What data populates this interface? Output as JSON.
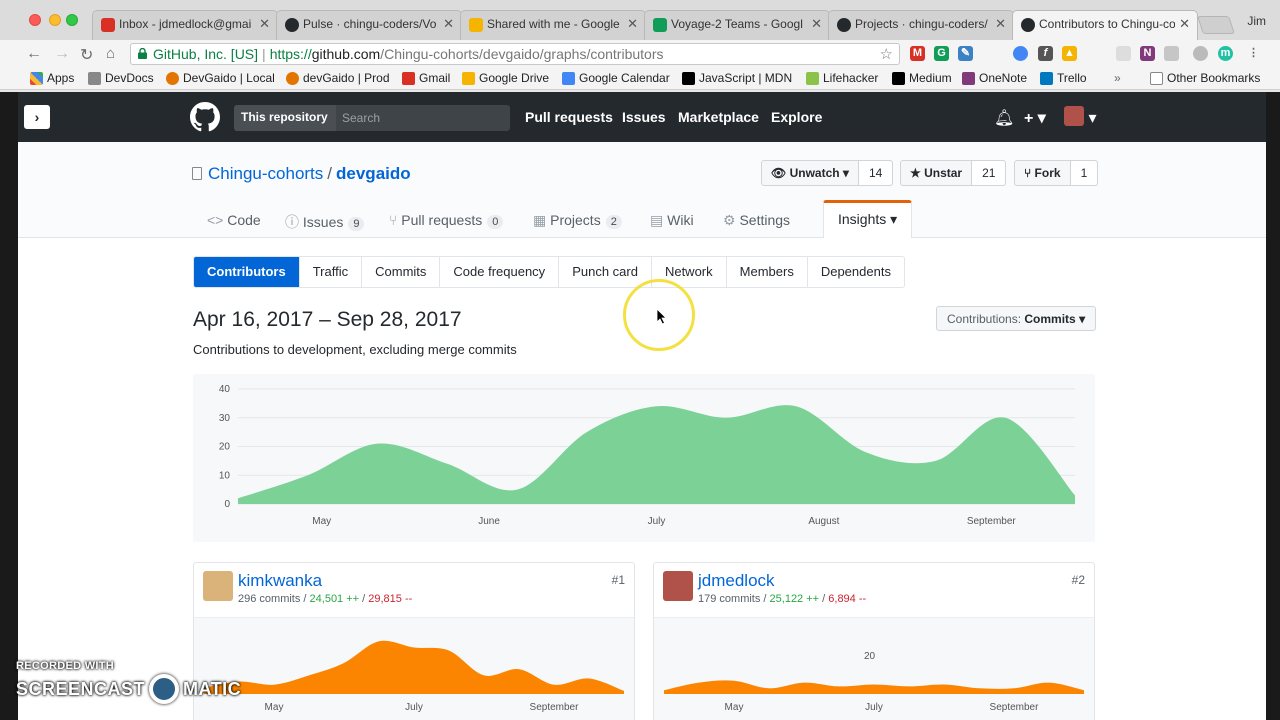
{
  "browser": {
    "tabs": [
      {
        "label": "Inbox - jdmedlock@gmai",
        "favicon_color": "#d93025",
        "active": false
      },
      {
        "label": "Pulse · chingu-coders/Vo",
        "favicon_color": "#24292e",
        "active": false
      },
      {
        "label": "Shared with me - Google",
        "favicon_color": "#f4b400",
        "active": false
      },
      {
        "label": "Voyage-2 Teams - Googl",
        "favicon_color": "#0f9d58",
        "active": false
      },
      {
        "label": "Projects · chingu-coders/",
        "favicon_color": "#24292e",
        "active": false
      },
      {
        "label": "Contributors to Chingu-co",
        "favicon_color": "#24292e",
        "active": true
      }
    ],
    "profile_name": "Jim",
    "address": {
      "secure_label": "GitHub, Inc. [US]",
      "protocol": "https://",
      "host": "github.com",
      "path": "/Chingu-cohorts/devgaido/graphs/contributors"
    },
    "bookmarks": [
      {
        "label": "Apps",
        "color": "#e8453c"
      },
      {
        "label": "DevDocs",
        "color": "#888888"
      },
      {
        "label": "DevGaido | Local",
        "color": "#e37400"
      },
      {
        "label": "devGaido | Prod",
        "color": "#e37400"
      },
      {
        "label": "Gmail",
        "color": "#d93025"
      },
      {
        "label": "Google Drive",
        "color": "#f4b400"
      },
      {
        "label": "Google Calendar",
        "color": "#4285f4"
      },
      {
        "label": "JavaScript | MDN",
        "color": "#000000"
      },
      {
        "label": "Lifehacker",
        "color": "#8bc34a"
      },
      {
        "label": "Medium",
        "color": "#000000"
      },
      {
        "label": "OneNote",
        "color": "#80397b"
      },
      {
        "label": "Trello",
        "color": "#0079bf"
      }
    ],
    "bookmarks_overflow": "»",
    "other_bookmarks": "Other Bookmarks"
  },
  "github": {
    "search_scope": "This repository",
    "search_placeholder": "Search",
    "nav": [
      "Pull requests",
      "Issues",
      "Marketplace",
      "Explore"
    ],
    "repo_owner": "Chingu-cohorts",
    "repo_name": "devgaido",
    "buttons": {
      "watch": {
        "label": "Unwatch ▾",
        "count": "14"
      },
      "star": {
        "label": "Unstar",
        "count": "21"
      },
      "fork": {
        "label": "Fork",
        "count": "1"
      }
    },
    "reponav": [
      {
        "label": "Code",
        "count": "",
        "icon": "<>"
      },
      {
        "label": "Issues",
        "count": "9",
        "icon": "ⓘ"
      },
      {
        "label": "Pull requests",
        "count": "0",
        "icon": "⑂"
      },
      {
        "label": "Projects",
        "count": "2",
        "icon": "▦"
      },
      {
        "label": "Wiki",
        "count": "",
        "icon": "▤"
      },
      {
        "label": "Settings",
        "count": "",
        "icon": "⚙"
      },
      {
        "label": "Insights ▾",
        "count": "",
        "icon": ""
      }
    ],
    "subnav": [
      "Contributors",
      "Traffic",
      "Commits",
      "Code frequency",
      "Punch card",
      "Network",
      "Members",
      "Dependents"
    ],
    "date_range": "Apr 16, 2017 – Sep 28, 2017",
    "subtitle": "Contributions to development, excluding merge commits",
    "contributions_select": {
      "prefix": "Contributions:",
      "value": "Commits ▾"
    }
  },
  "chart_data": [
    {
      "type": "area",
      "title": "",
      "xlabel": "",
      "ylabel": "",
      "color": "#7bd196",
      "x_ticks": [
        "May",
        "June",
        "July",
        "August",
        "September"
      ],
      "y_ticks": [
        0,
        10,
        20,
        30,
        40
      ],
      "ylim": [
        0,
        40
      ],
      "x": [
        "Apr 16",
        "Apr 30",
        "May 14",
        "May 28",
        "Jun 11",
        "Jun 25",
        "Jul 9",
        "Jul 23",
        "Aug 6",
        "Aug 20",
        "Sep 3",
        "Sep 17",
        "Sep 28"
      ],
      "values": [
        2,
        10,
        21,
        14,
        5,
        25,
        34,
        30,
        34,
        18,
        15,
        30,
        3
      ]
    },
    {
      "type": "area",
      "title": "kimkwanka",
      "color": "#fb8500",
      "x_ticks": [
        "May",
        "July",
        "September"
      ],
      "values": [
        2,
        4,
        3,
        6,
        10,
        17,
        15,
        14,
        6,
        8,
        3,
        5,
        1
      ]
    },
    {
      "type": "area",
      "title": "jdmedlock",
      "color": "#fb8500",
      "x_ticks": [
        "May",
        "July",
        "September"
      ],
      "y_ticks": [
        20
      ],
      "values": [
        2,
        6,
        7,
        3,
        6,
        4,
        5,
        4,
        5,
        3,
        3,
        6,
        2
      ]
    }
  ],
  "contributors": [
    {
      "username": "kimkwanka",
      "rank": "#1",
      "commits": "296 commits",
      "additions": "24,501 ++",
      "deletions": "29,815 --",
      "avatar_color": "#d9b37a"
    },
    {
      "username": "jdmedlock",
      "rank": "#2",
      "commits": "179 commits",
      "additions": "25,122 ++",
      "deletions": "6,894 --",
      "avatar_color": "#b0524a"
    }
  ],
  "watermark": {
    "line1": "RECORDED WITH",
    "line2a": "SCREENCAST",
    "line2b": "MATIC"
  }
}
